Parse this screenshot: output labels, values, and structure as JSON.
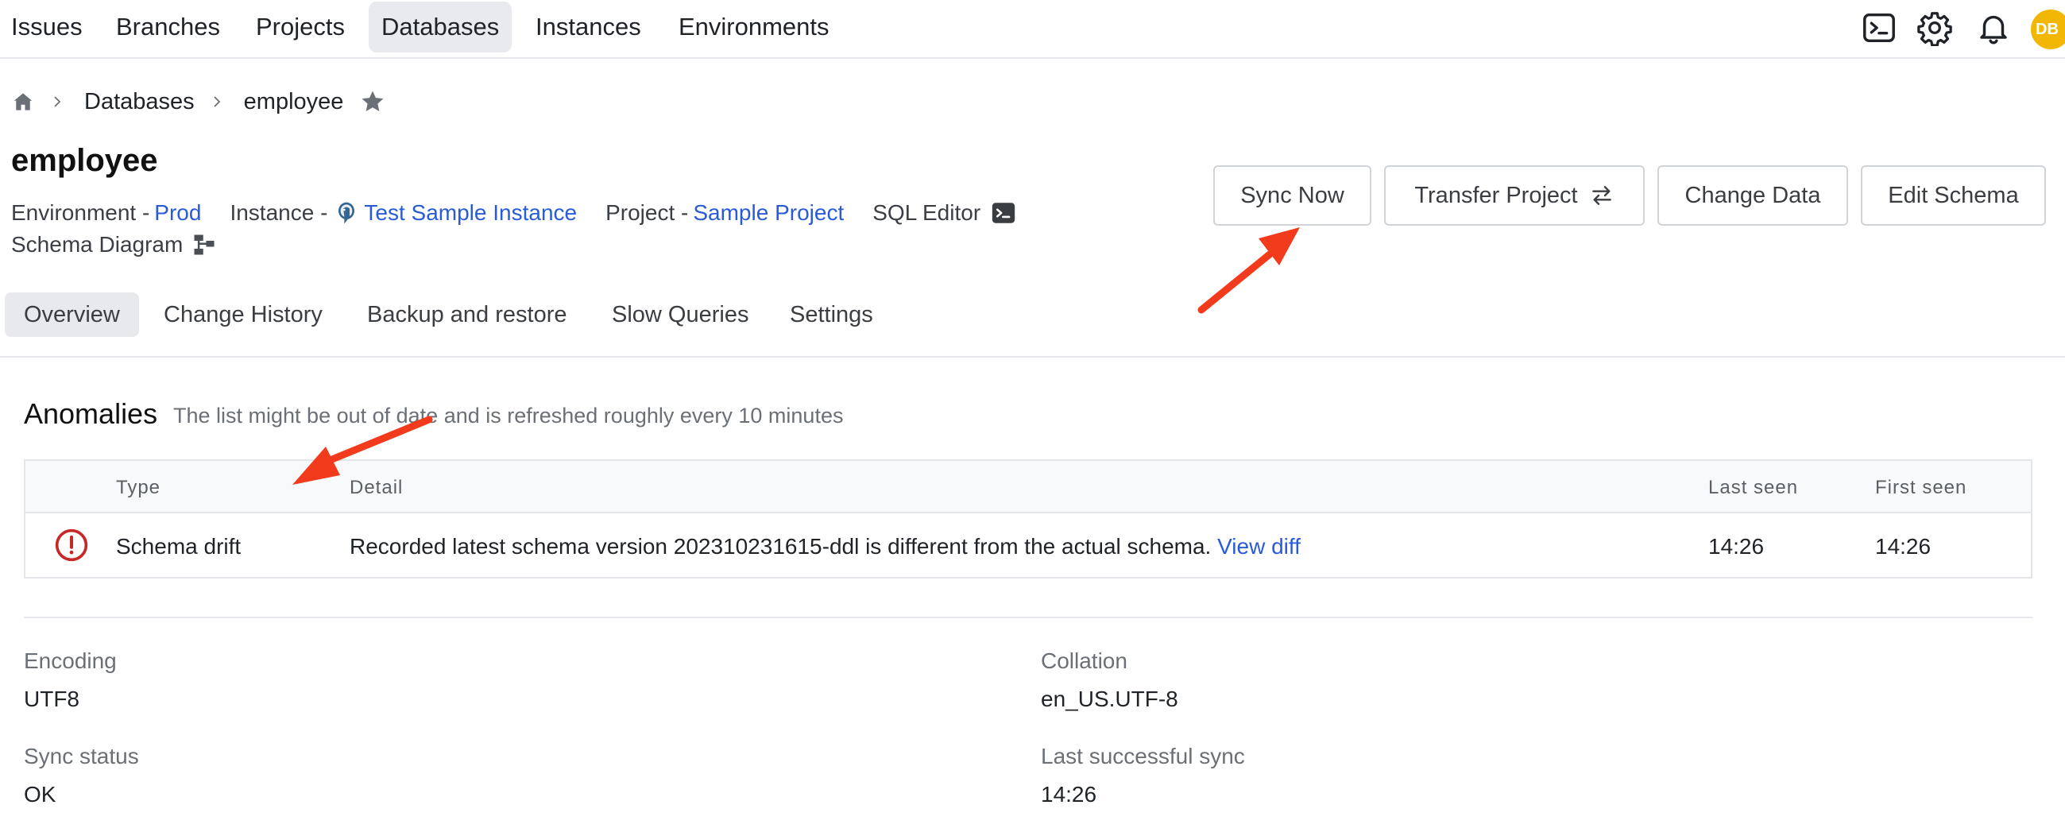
{
  "nav": {
    "items": [
      {
        "label": "Issues"
      },
      {
        "label": "Branches"
      },
      {
        "label": "Projects"
      },
      {
        "label": "Databases"
      },
      {
        "label": "Instances"
      },
      {
        "label": "Environments"
      }
    ],
    "active": "Databases",
    "avatar_initials": "DB"
  },
  "breadcrumb": {
    "databases": "Databases",
    "current": "employee"
  },
  "page": {
    "title": "employee",
    "environment_label": "Environment -",
    "environment_value": "Prod",
    "instance_label": "Instance -",
    "instance_value": "Test Sample Instance",
    "project_label": "Project -",
    "project_value": "Sample Project",
    "sql_editor_label": "SQL Editor",
    "schema_diagram_label": "Schema Diagram"
  },
  "actions": {
    "sync_now": "Sync Now",
    "transfer_project": "Transfer Project",
    "change_data": "Change Data",
    "edit_schema": "Edit Schema"
  },
  "tabs": [
    {
      "label": "Overview"
    },
    {
      "label": "Change History"
    },
    {
      "label": "Backup and restore"
    },
    {
      "label": "Slow Queries"
    },
    {
      "label": "Settings"
    }
  ],
  "anomalies": {
    "title": "Anomalies",
    "subtitle": "The list might be out of date and is refreshed roughly every 10 minutes",
    "columns": {
      "type": "Type",
      "detail": "Detail",
      "last_seen": "Last seen",
      "first_seen": "First seen"
    },
    "rows": [
      {
        "type": "Schema drift",
        "detail": "Recorded latest schema version 202310231615-ddl is different from the actual schema.",
        "link": "View diff",
        "last_seen": "14:26",
        "first_seen": "14:26"
      }
    ]
  },
  "info": {
    "encoding_label": "Encoding",
    "encoding_value": "UTF8",
    "collation_label": "Collation",
    "collation_value": "en_US.UTF-8",
    "sync_status_label": "Sync status",
    "sync_status_value": "OK",
    "last_sync_label": "Last successful sync",
    "last_sync_value": "14:26"
  },
  "colors": {
    "link": "#2a5bd7",
    "error": "#c62828",
    "annotation_arrow": "#f23b1c",
    "avatar": "#f2b705"
  },
  "icons": [
    "terminal-icon",
    "gear-icon",
    "bell-icon",
    "home-icon",
    "chevron-right-icon",
    "star-icon",
    "postgres-icon",
    "swap-icon",
    "schema-diagram-icon",
    "error-icon"
  ]
}
